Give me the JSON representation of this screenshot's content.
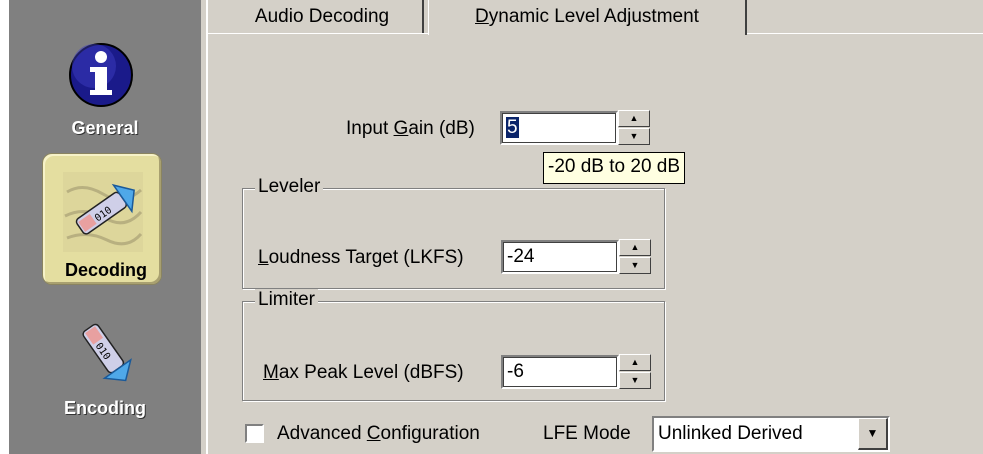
{
  "nav": {
    "items": [
      {
        "label": "General",
        "icon": "info-icon"
      },
      {
        "label": "Decoding",
        "icon": "decoding-icon",
        "selected": true
      },
      {
        "label": "Encoding",
        "icon": "encoding-icon"
      }
    ]
  },
  "tabs": [
    {
      "label_pre": "Audio Decoding",
      "label_u": "",
      "label_post": ""
    },
    {
      "label_pre": "",
      "label_u": "D",
      "label_post": "ynamic Level Adjustment",
      "active": true
    }
  ],
  "input_gain": {
    "label_pre": "Input ",
    "label_u": "G",
    "label_post": "ain (dB)",
    "value": "5",
    "tooltip": "-20 dB to 20 dB"
  },
  "leveler": {
    "title": "Leveler",
    "label_pre": "",
    "label_u": "L",
    "label_post": "oudness Target (LKFS)",
    "value": "-24"
  },
  "limiter": {
    "title": "Limiter",
    "label_pre": "",
    "label_u": "M",
    "label_post": "ax Peak Level (dBFS)",
    "value": "-6"
  },
  "advanced": {
    "label_pre": "Advanced ",
    "label_u": "C",
    "label_post": "onfiguration",
    "checked": false
  },
  "lfe": {
    "label": "LFE Mode",
    "value": "Unlinked Derived"
  },
  "colors": {
    "nav_bg": "#808080",
    "panel_bg": "#d4d0c8",
    "selection": "#0a246a",
    "tooltip_bg": "#ffffe1",
    "info_blue": "#1a1a8a"
  }
}
